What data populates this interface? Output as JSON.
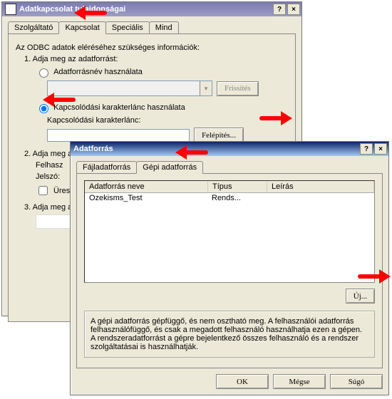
{
  "dlg1": {
    "title": "Adatkapcsolat tulajdonságai",
    "tabs": [
      "Szolgáltató",
      "Kapcsolat",
      "Speciális",
      "Mind"
    ],
    "activeTab": 1,
    "heading": "Az ODBC adatok eléréséhez szükséges információk:",
    "step1": "1. Adja meg az adatforrást:",
    "opt_dsn": "Adatforrásnév használata",
    "btn_refresh": "Frissítés",
    "opt_connstr": "Kapcsolódási karakterlánc használata",
    "connstr_label": "Kapcsolódási karakterlánc:",
    "connstr_value": "",
    "btn_build": "Felépítés...",
    "step2": "2. Adja meg a",
    "user_label": "Felhasz",
    "pass_label": "Jelszó:",
    "blank_pw": "Üres",
    "step3": "3. Adja meg a"
  },
  "dlg2": {
    "title": "Adatforrás",
    "tabs": [
      "Fájladatforrás",
      "Gépi adatforrás"
    ],
    "activeTab": 1,
    "cols": {
      "name": "Adatforrás neve",
      "type": "Típus",
      "desc": "Leírás"
    },
    "rows": [
      {
        "name": "Ozekisms_Test",
        "type": "Rends...",
        "desc": ""
      }
    ],
    "btn_new": "Új...",
    "info": "A gépi adatforrás gépfüggő, és nem osztható meg. A felhasználói adatforrás felhasználófüggő, és csak a megadott felhasználó használhatja ezen a gépen. A rendszeradatforrást a gépre bejelentkező összes felhasználó és a rendszer szolgáltatásai is használhatják.",
    "btn_ok": "OK",
    "btn_cancel": "Mégse",
    "btn_help": "Súgó"
  }
}
